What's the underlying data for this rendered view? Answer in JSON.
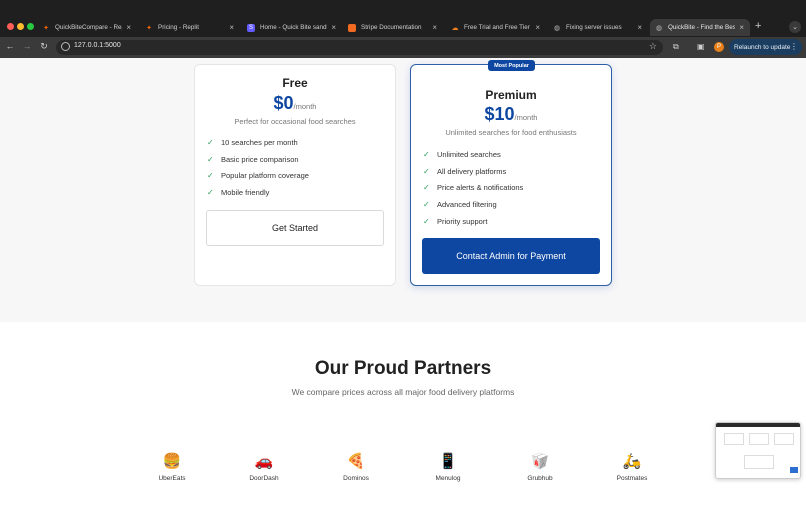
{
  "browser": {
    "tabs": [
      {
        "title": "QuickBiteCompare - Replit",
        "icon": "replit-icon"
      },
      {
        "title": "Pricing - Replit",
        "icon": "replit-icon"
      },
      {
        "title": "Home - Quick Bite sandbox",
        "icon": "stripe-icon"
      },
      {
        "title": "Stripe Documentation",
        "icon": "stripe-docs-icon"
      },
      {
        "title": "Free Trial and Free Tier Se",
        "icon": "cloud-icon"
      },
      {
        "title": "Fixing server issues",
        "icon": "globe-icon"
      },
      {
        "title": "QuickBite - Find the Best",
        "icon": "globe-icon"
      }
    ],
    "url": "127.0.0.1:5000",
    "profile_initial": "P",
    "relaunch_label": "Relaunch to update"
  },
  "pricing": {
    "free": {
      "name": "Free",
      "price": "$0",
      "period": "/month",
      "subtitle": "Perfect for occasional food searches",
      "features": [
        "10 searches per month",
        "Basic price comparison",
        "Popular platform coverage",
        "Mobile friendly"
      ],
      "button": "Get Started"
    },
    "premium": {
      "badge": "Most Popular",
      "name": "Premium",
      "price": "$10",
      "period": "/month",
      "subtitle": "Unlimited searches for food enthusiasts",
      "features": [
        "Unlimited searches",
        "All delivery platforms",
        "Price alerts & notifications",
        "Advanced filtering",
        "Priority support"
      ],
      "button": "Contact Admin for Payment"
    }
  },
  "partners": {
    "title": "Our Proud Partners",
    "subtitle": "We compare prices across all major food delivery platforms",
    "items": [
      {
        "name": "UberEats",
        "emoji": "🍔"
      },
      {
        "name": "DoorDash",
        "emoji": "🚗"
      },
      {
        "name": "Dominos",
        "emoji": "🍕"
      },
      {
        "name": "Menulog",
        "emoji": "📱"
      },
      {
        "name": "Grubhub",
        "emoji": "🥡"
      },
      {
        "name": "Postmates",
        "emoji": "🛵"
      }
    ]
  },
  "colors": {
    "brand_blue": "#0d47a1",
    "check_green": "#2e9d5a"
  }
}
